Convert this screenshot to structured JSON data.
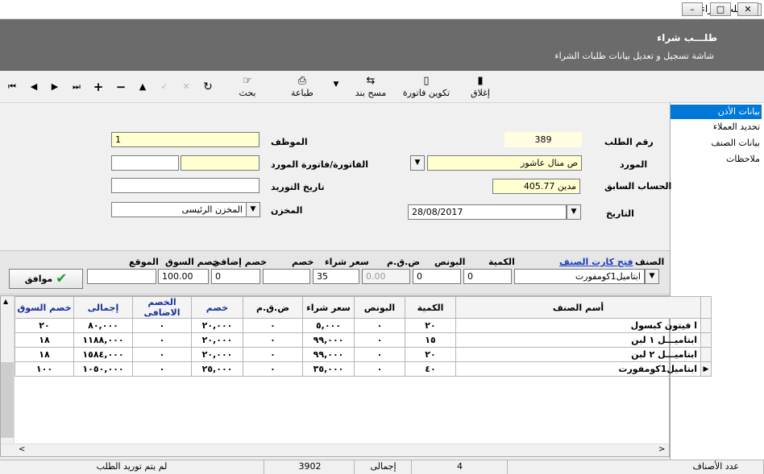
{
  "window": {
    "title": "طلب شراء"
  },
  "header": {
    "title": "طلـــب شراء",
    "subtitle": "شاشة تسجيل  و تعديل بيانات طلبات الشراء"
  },
  "toolbar": {
    "close_label": "إغلاق",
    "invoice_label": "تكوين فاتورة",
    "clear_item_label": "مسح بند",
    "print_label": "طباعة",
    "search_label": "بحث"
  },
  "side_panel": {
    "items": [
      {
        "label": "بيانات الأذن"
      },
      {
        "label": "تحديد العملاء"
      },
      {
        "label": "بيانات الصنف"
      },
      {
        "label": "ملاحظات"
      }
    ]
  },
  "form": {
    "order_no_label": "رقم الطلب",
    "order_no": "389",
    "employee_label": "الموظف",
    "employee": "1",
    "supplier_label": "المورد",
    "supplier": "ص منال عاشور",
    "supplier_invoice_label": "الفاتورة/فاتورة المورد",
    "supplier_invoice": "",
    "supplier_invoice_2": "",
    "prev_balance_label": "الحساب السابق",
    "prev_balance": "مدين 405.77",
    "delivery_date_label": "تاريخ التوريد",
    "delivery_date": "",
    "warehouse_label": "المخزن",
    "warehouse": "المخزن الرئيسى",
    "date_label": "التاريخ",
    "date": "28/08/2017"
  },
  "entry": {
    "item_label": "الصنف",
    "item_card_link": "فتح كارت الصنف",
    "qty_label": "الكمية",
    "bonus_label": "البونص",
    "vat_label": "ض.ق.م",
    "price_label": "سعر شراء",
    "discount_label": "خصم",
    "extra_discount_label": "خصم إضافي",
    "market_discount_label": "خصم السوق",
    "location_label": "الموقع",
    "item_value": "ابتاميل1كومفورت",
    "qty_value": "0",
    "bonus_value": "0",
    "vat_value": "0.00",
    "price_value": "35",
    "discount_value": "",
    "extra_discount_value": "0",
    "market_discount_value": "100.00",
    "location_value": "",
    "ok_label": "موافق"
  },
  "grid": {
    "columns": [
      "أسم الصنف",
      "الكمية",
      "البونص",
      "سعر شراء",
      "ض.ق.م",
      "خصم",
      "الخصم الاضافى",
      "إجمالى",
      "خصم السوق"
    ],
    "rows": [
      [
        "ا فيتون كبسول",
        "٢٠",
        "٠",
        "٥,٠٠٠",
        "٠",
        "٢٠,٠٠٠",
        "٠",
        "٨٠,٠٠٠",
        "٢٠"
      ],
      [
        "ابتاميـــل ١ لبن",
        "١٥",
        "٠",
        "٩٩,٠٠٠",
        "٠",
        "٢٠,٠٠٠",
        "٠",
        "١١٨٨,٠٠٠",
        "١٨"
      ],
      [
        "ابتاميـــل ٢ لبن",
        "٢٠",
        "٠",
        "٩٩,٠٠٠",
        "٠",
        "٢٠,٠٠٠",
        "٠",
        "١٥٨٤,٠٠٠",
        "١٨"
      ],
      [
        "ابتاميل1كومفورت",
        "٤٠",
        "٠",
        "٣٥,٠٠٠",
        "٠",
        "٢٥,٠٠٠",
        "٠",
        "١٠٥٠,٠٠٠",
        "١٠٠"
      ]
    ]
  },
  "status": {
    "items_count_label": "عدد الأصناف",
    "items_count": "4",
    "total_label": "إجمالى",
    "total": "3902",
    "state": "لم يتم توريد الطلب"
  }
}
